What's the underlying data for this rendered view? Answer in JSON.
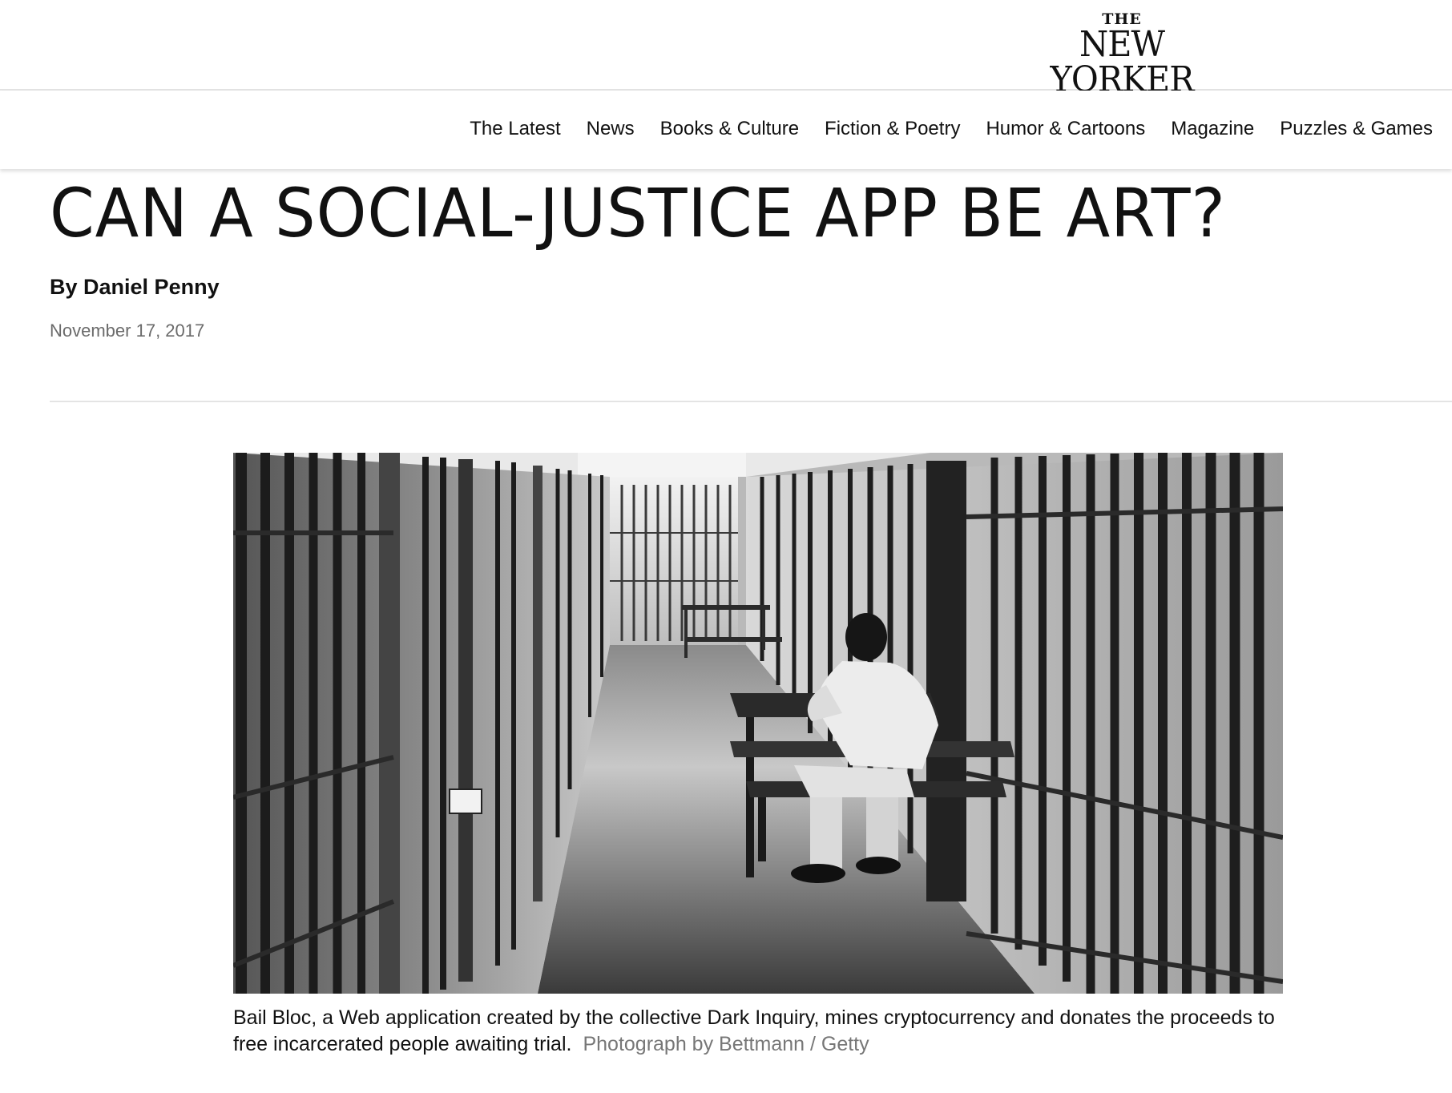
{
  "masthead": {
    "logo_the": "THE",
    "logo_main": "NEW YORKER"
  },
  "nav": {
    "items": [
      {
        "label": "The Latest"
      },
      {
        "label": "News"
      },
      {
        "label": "Books & Culture"
      },
      {
        "label": "Fiction & Poetry"
      },
      {
        "label": "Humor & Cartoons"
      },
      {
        "label": "Magazine"
      },
      {
        "label": "Puzzles & Games"
      }
    ]
  },
  "article": {
    "headline": "CAN A SOCIAL-JUSTICE APP BE ART?",
    "byline_prefix": "By ",
    "author": "Daniel Penny",
    "date": "November 17, 2017"
  },
  "photo": {
    "caption": "Bail Bloc, a Web application created by the collective Dark Inquiry, mines cryptocurrency and donates the proceeds to free incarcerated people awaiting trial.",
    "credit": "Photograph by Bettmann / Getty"
  }
}
